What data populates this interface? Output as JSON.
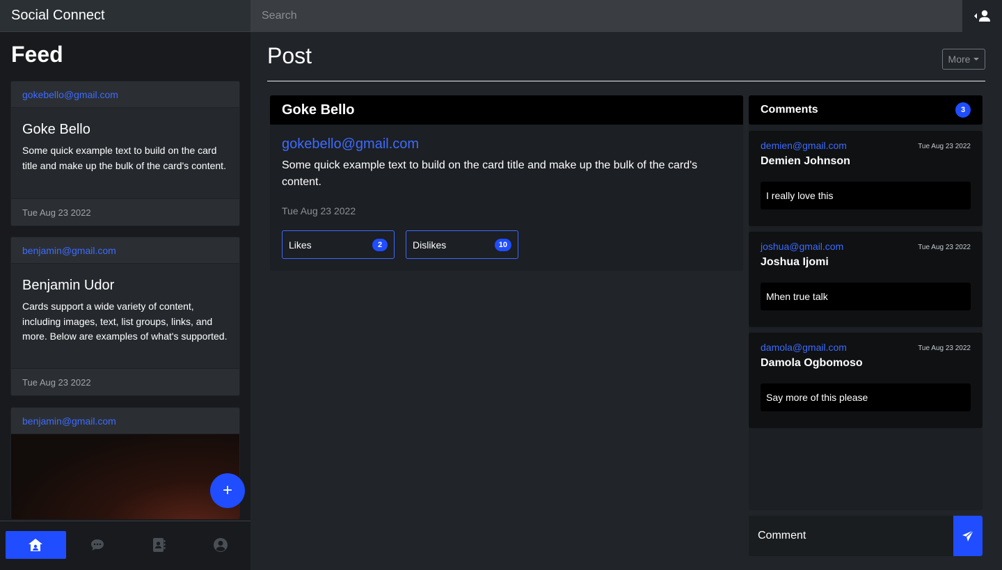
{
  "app": {
    "title": "Social Connect"
  },
  "search": {
    "placeholder": "Search"
  },
  "sidebar": {
    "title": "Feed",
    "cards": [
      {
        "email": "gokebello@gmail.com",
        "name": "Goke Bello",
        "text": "Some quick example text to build on the card title and make up the bulk of the card's content.",
        "date": "Tue Aug 23 2022"
      },
      {
        "email": "benjamin@gmail.com",
        "name": "Benjamin Udor",
        "text": "Cards support a wide variety of content, including images, text, list groups, links, and more. Below are examples of what's supported.",
        "date": "Tue Aug 23 2022"
      },
      {
        "email": "benjamin@gmail.com"
      }
    ],
    "fab_label": "+"
  },
  "bottom_nav": {
    "items": [
      {
        "icon": "home-icon",
        "active": true
      },
      {
        "icon": "chat-icon",
        "active": false
      },
      {
        "icon": "contacts-icon",
        "active": false
      },
      {
        "icon": "user-circle-icon",
        "active": false
      }
    ]
  },
  "main": {
    "title": "Post",
    "more_label": "More",
    "post": {
      "author": "Goke Bello",
      "email": "gokebello@gmail.com",
      "text": "Some quick example text to build on the card title and make up the bulk of the card's content.",
      "date": "Tue Aug 23 2022",
      "likes_label": "Likes",
      "likes_count": "2",
      "dislikes_label": "Dislikes",
      "dislikes_count": "10"
    }
  },
  "comments": {
    "title": "Comments",
    "count": "3",
    "items": [
      {
        "email": "demien@gmail.com",
        "date": "Tue Aug 23 2022",
        "name": "Demien Johnson",
        "text": "I really love this"
      },
      {
        "email": "joshua@gmail.com",
        "date": "Tue Aug 23 2022",
        "name": "Joshua Ijomi",
        "text": "Mhen true talk"
      },
      {
        "email": "damola@gmail.com",
        "date": "Tue Aug 23 2022",
        "name": "Damola Ogbomoso",
        "text": "Say more of this please"
      }
    ],
    "input_placeholder": "Comment"
  },
  "colors": {
    "accent": "#1f4dff",
    "link": "#3d6bff",
    "background": "#212529",
    "sidebar": "#181a1d"
  }
}
